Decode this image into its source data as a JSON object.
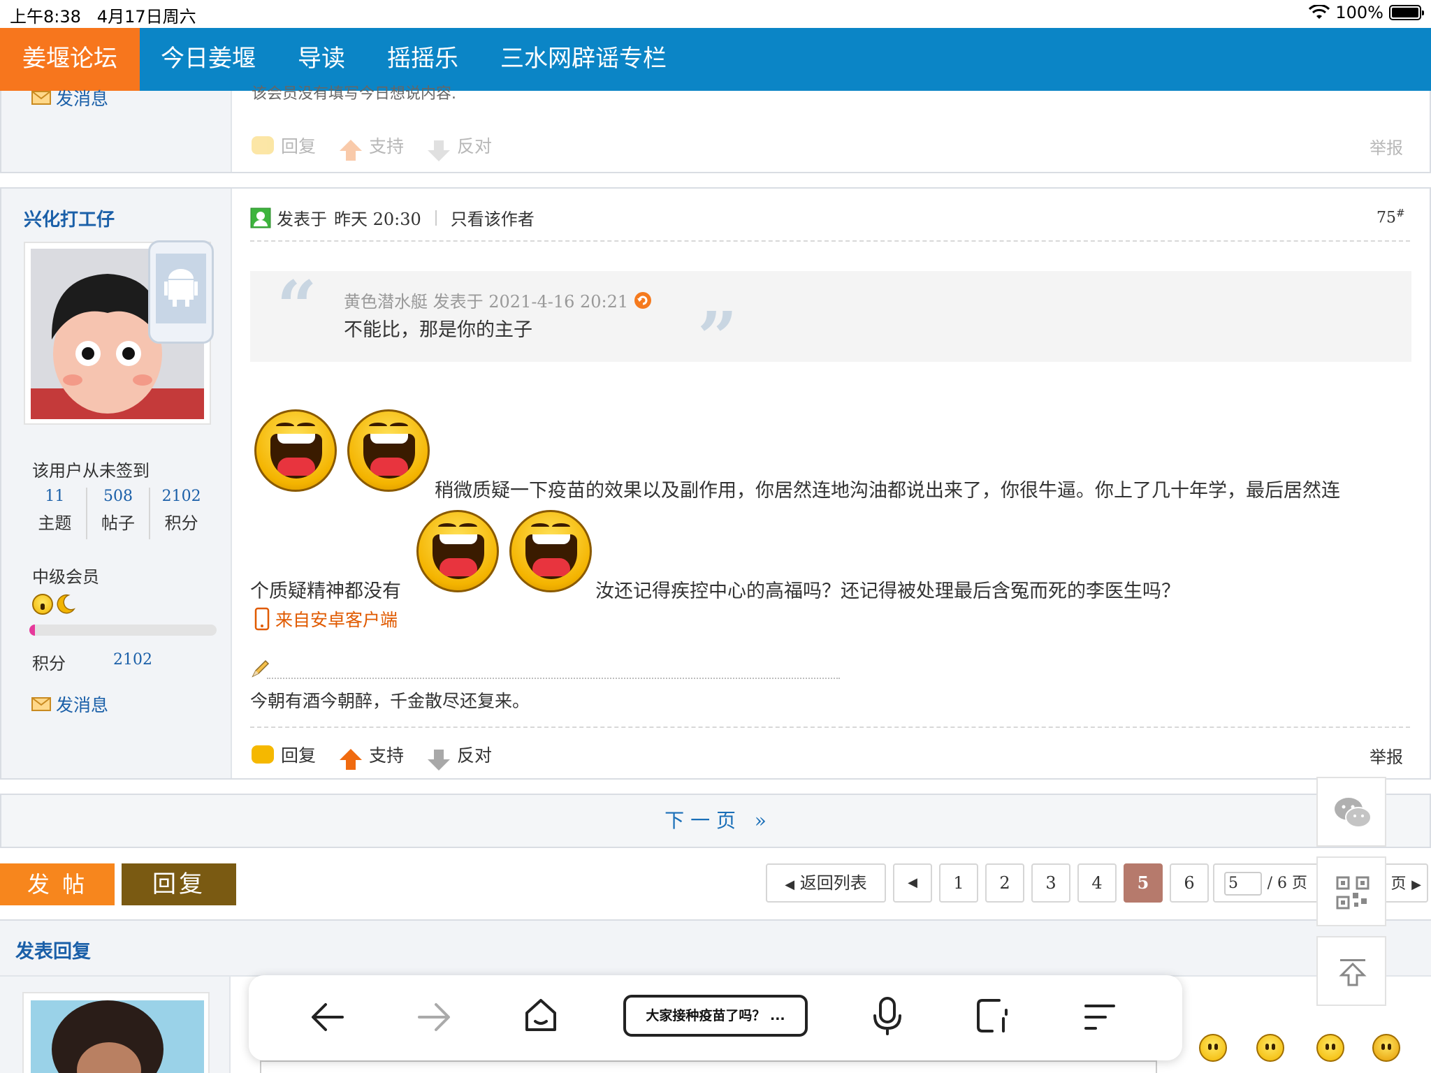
{
  "status": {
    "time": "上午8:38",
    "date": "4月17日周六",
    "battery": "100%"
  },
  "nav": {
    "items": [
      {
        "label": "姜堰论坛",
        "active": true
      },
      {
        "label": "今日姜堰"
      },
      {
        "label": "导读"
      },
      {
        "label": "摇摇乐"
      },
      {
        "label": "三水网辟谣专栏"
      }
    ]
  },
  "prev_post": {
    "send_msg": "发消息",
    "partial_text": "该会员没有填写今日想说内容.",
    "actions": {
      "reply": "回复",
      "support": "支持",
      "oppose": "反对",
      "report": "举报"
    }
  },
  "post": {
    "username": "兴化打工仔",
    "signin_status": "该用户从未签到",
    "stats": [
      {
        "value": "11",
        "label": "主题"
      },
      {
        "value": "508",
        "label": "帖子"
      },
      {
        "value": "2102",
        "label": "积分"
      }
    ],
    "rank": "中级会员",
    "points_label": "积分",
    "points_value": "2102",
    "send_msg": "发消息",
    "posted_label": "发表于",
    "posted_time": "昨天 20:30",
    "only_author": "只看该作者",
    "floor": "75",
    "floor_sup": "#",
    "quote": {
      "author_line": "黄色潜水艇 发表于 2021-4-16 20:21",
      "text": "不能比，那是你的主子"
    },
    "body_line1": "稍微质疑一下疫苗的效果以及副作用，你居然连地沟油都说出来了，你很牛逼。你上了几十年学，最后居然连",
    "body_line2a": "个质疑精神都没有",
    "body_line2b": "汝还记得疾控中心的高福吗？还记得被处理最后含冤而死的李医生吗？",
    "client": "来自安卓客户端",
    "signature": "今朝有酒今朝醉，千金散尽还复来。",
    "actions": {
      "reply": "回复",
      "support": "支持",
      "oppose": "反对",
      "report": "举报"
    }
  },
  "next_page": {
    "label": "下 一 页",
    "arrow": "»"
  },
  "buttons": {
    "new_post": "发 帖",
    "reply": "回复"
  },
  "pagination": {
    "back": "返回列表",
    "pages": [
      "1",
      "2",
      "3",
      "4",
      "5",
      "6"
    ],
    "current": "5",
    "input_value": "5",
    "total": "/ 6 页",
    "next_partial": "页"
  },
  "reply_section": {
    "title": "发表回复"
  },
  "browser": {
    "search_text": "大家接种疫苗了吗？ ..."
  },
  "colors": {
    "nav": "#0b85c6",
    "nav_active": "#f7761d",
    "link": "#1a5fa8",
    "post_btn": "#f7861d",
    "reply_btn": "#7a5a12",
    "current_page": "#b67a6c"
  }
}
